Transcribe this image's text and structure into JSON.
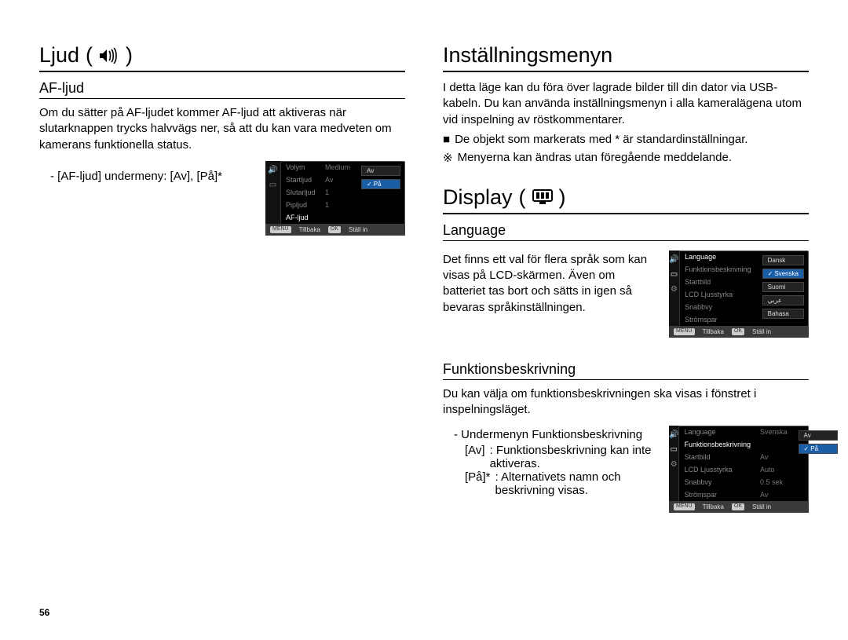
{
  "left": {
    "heading": "Ljud",
    "heading_paren_open": "(",
    "heading_paren_close": ")",
    "section1_title": "AF-ljud",
    "section1_body": "Om du sätter på AF-ljudet kommer AF-ljud att aktiveras när slutarknappen trycks halvvägs ner, så att du kan vara medveten om kamerans funktionella status.",
    "section1_sub": "- [AF-ljud] undermeny: [Av], [På]*",
    "lcd1": {
      "rows": [
        {
          "k": "Volym",
          "v": "Medium"
        },
        {
          "k": "Startljud",
          "v": "Av"
        },
        {
          "k": "Slutarljud",
          "v": "1"
        },
        {
          "k": "Pipljud",
          "v": "1"
        },
        {
          "k": "AF-ljud",
          "v": ""
        }
      ],
      "opts": [
        "Av",
        "På"
      ],
      "foot_back": "Tillbaka",
      "foot_set": "Ställ in"
    }
  },
  "right": {
    "heading1": "Inställningsmenyn",
    "intro": "I detta läge kan du föra över lagrade bilder till din dator via USB-kabeln. Du kan använda inställningsmenyn i alla kameralägena utom vid inspelning av röstkommentarer.",
    "bullet1_sym": "■",
    "bullet1": "De objekt som markerats med * är standardinställningar.",
    "bullet2_sym": "※",
    "bullet2": "Menyerna kan ändras utan föregående meddelande.",
    "heading2": "Display",
    "heading2_paren_open": "(",
    "heading2_paren_close": ")",
    "lang_title": "Language",
    "lang_body": "Det finns ett val för flera språk som kan visas på LCD-skärmen. Även om batteriet tas bort och sätts in igen så bevaras språkinställningen.",
    "lcd2": {
      "rows": [
        {
          "k": "Language",
          "v": ""
        },
        {
          "k": "Funktionsbeskrivning",
          "v": ""
        },
        {
          "k": "Startbild",
          "v": ""
        },
        {
          "k": "LCD Ljusstyrka",
          "v": ""
        },
        {
          "k": "Snabbvy",
          "v": ""
        },
        {
          "k": "Strömspar",
          "v": ""
        }
      ],
      "opts": [
        "Dansk",
        "Svenska",
        "Suomi",
        "عربي",
        "Bahasa"
      ],
      "foot_back": "Tillbaka",
      "foot_set": "Ställ in"
    },
    "func_title": "Funktionsbeskrivning",
    "func_body": "Du kan välja om funktionsbeskrivningen ska visas i fönstret i inspelningsläget.",
    "func_sub": "- Undermenyn Funktionsbeskrivning",
    "func_opt1_label": "[Av]",
    "func_opt1_text": ": Funktionsbeskrivning kan inte aktiveras.",
    "func_opt2_label": "[På]*",
    "func_opt2_text": ": Alternativets namn och beskrivning visas.",
    "lcd3": {
      "rows": [
        {
          "k": "Language",
          "v": "Svenska"
        },
        {
          "k": "Funktionsbeskrivning",
          "v": ""
        },
        {
          "k": "Startbild",
          "v": "Av"
        },
        {
          "k": "LCD Ljusstyrka",
          "v": "Auto"
        },
        {
          "k": "Snabbvy",
          "v": "0.5 sek"
        },
        {
          "k": "Strömspar",
          "v": "Av"
        }
      ],
      "opts": [
        "Av",
        "På"
      ],
      "foot_back": "Tillbaka",
      "foot_set": "Ställ in"
    }
  },
  "page_number": "56",
  "lcd_menu_label": "MENU",
  "lcd_ok_label": "OK"
}
